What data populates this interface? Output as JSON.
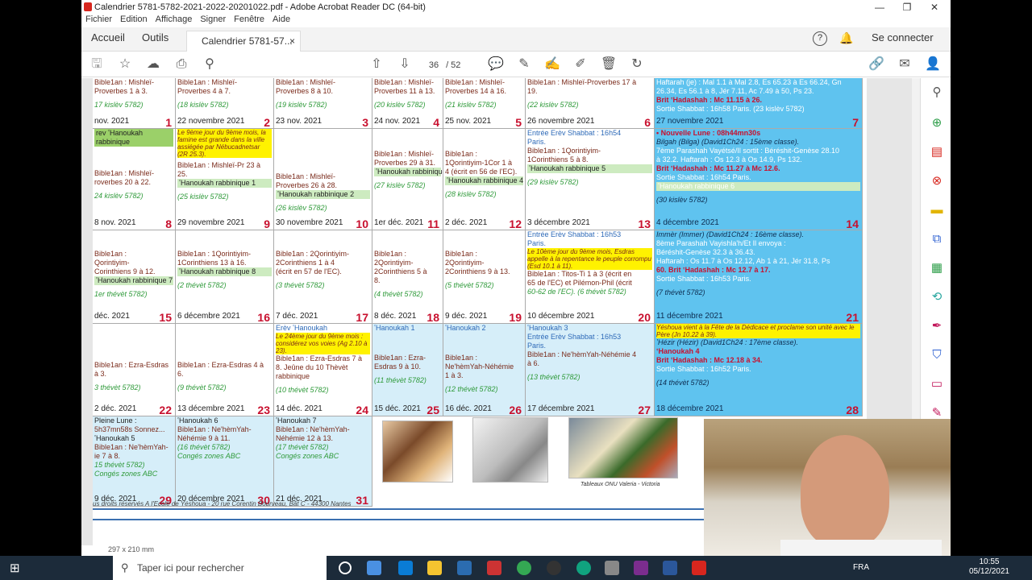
{
  "window": {
    "title": "Calendrier 5781-5782-2021-2022-20201022.pdf - Adobe Acrobat Reader DC (64-bit)",
    "minimize": "—",
    "maximize": "❐",
    "close": "✕"
  },
  "menu": [
    "Fichier",
    "Edition",
    "Affichage",
    "Signer",
    "Fenêtre",
    "Aide"
  ],
  "tabs": {
    "home": "Accueil",
    "tools": "Outils",
    "doc": "Calendrier 5781-57...",
    "close": "×",
    "signin": "Se connecter"
  },
  "toolbar": {
    "page_current": "36",
    "page_total": "/ 52"
  },
  "calendar": {
    "row1": [
      {
        "lines": [
          "Bible1an : Mishleï-",
          "Proverbes 1 à 3."
        ],
        "kislev": "17 kislèv 5782)",
        "date": "nov. 2021",
        "num": "1"
      },
      {
        "lines": [
          "Bible1an : Mishleï-",
          "Proverbes 4 à 7."
        ],
        "kislev": "(18 kislèv 5782)",
        "date": "22 novembre 2021",
        "num": "2"
      },
      {
        "lines": [
          "Bible1an : Mishleï-",
          "Proverbes 8 à 10."
        ],
        "kislev": "(19 kislèv 5782)",
        "date": "23 nov. 2021",
        "num": "3"
      },
      {
        "lines": [
          "Bible1an : Mishleï-",
          "Proverbes 11 à 13."
        ],
        "kislev": "(20 kislèv 5782)",
        "date": "24 nov. 2021",
        "num": "4"
      },
      {
        "lines": [
          "Bible1an : Mishleï-",
          "Proverbes 14 à 16."
        ],
        "kislev": "(21 kislèv 5782)",
        "date": "25 nov. 2021",
        "num": "5"
      },
      {
        "lines": [
          "Bible1an : Mishleï-Proverbes 17 à",
          "19."
        ],
        "kislev": "(22 kislèv 5782)",
        "date": "26 novembre 2021",
        "num": "6"
      },
      {
        "lines": [
          "Haftarah (je) : Mal 1.1 à Mal 2.8, Es 65.23 à Es 66.24, Gn",
          "26.34, Es 56.1 à 8, Jér 7.11, Ac 7.49 à 50, Ps 23.",
          "Brit ʽHadashah : Mc 11.15 à 26.",
          "Sortie Shabbat : 16h58 Paris. (23 kislèv 5782)"
        ],
        "date": "27 novembre 2021",
        "num": "7"
      }
    ],
    "row2": [
      {
        "band": [
          "rev ʽHanoukah",
          "rabbinique"
        ],
        "lines": [
          "Bible1an : Mishleï-",
          "roverbes 20 à 22."
        ],
        "kislev": "24 kislèv 5782)",
        "date": "8 nov. 2021",
        "num": "8"
      },
      {
        "hi": "Le 9ème jour du 9ème mois, la famine est grande dans la ville assiégée par Nébucadnetsar (2R 25.3).",
        "lines": [
          "Bible1an : Mishleï-Pr 23 à",
          "25."
        ],
        "label": "ʽHanoukah rabbinique 1",
        "kislev": "(25 kislèv 5782)",
        "date": "29 novembre 2021",
        "num": "9"
      },
      {
        "lines": [
          "Bible1an : Mishleï-",
          "Proverbes 26 à 28."
        ],
        "label": "ʽHanoukah rabbinique 2",
        "kislev": "(26 kislèv 5782)",
        "date": "30 novembre 2021",
        "num": "10"
      },
      {
        "lines": [
          "Bible1an : Mishleï-",
          "Proverbes 29 à 31."
        ],
        "label": "ʽHanoukah rabbinique 3",
        "kislev": "(27 kislèv 5782)",
        "date": "1er déc. 2021",
        "num": "11"
      },
      {
        "lines": [
          "Bible1an :",
          "1Qorintiyim-1Cor 1 à",
          "4 (écrit en 56 de l'EC)."
        ],
        "label": "ʽHanoukah rabbinique 4",
        "kislev": "(28 kislèv 5782)",
        "date": "2 déc. 2021",
        "num": "12"
      },
      {
        "top": [
          "Entrée Erèv Shabbat : 16h54",
          "Paris."
        ],
        "lines": [
          "Bible1an : 1Qorintiyim-",
          "1Corinthiens 5 à 8."
        ],
        "label": "ʽHanoukah rabbinique 5",
        "kislev": "(29 kislèv 5782)",
        "date": "3 décembre 2021",
        "num": "13"
      },
      {
        "lines": [
          "• Nouvelle Lune : 08h44mn30s",
          "Bilgah (Bilga) (David1Ch24 : 15ème classe).",
          "7ème Parashah Vayétsé/Il sortit : Béréshit-Genèse 28.10",
          "à 32.2. Haftarah : Os 12.3 à Os 14.9, Ps 132.",
          "Brit ʽHadashah : Mc 11.27 à Mc 12.6.",
          "Sortie Shabbat : 16h54 Paris."
        ],
        "label": "ʽHanoukah rabbinique 6",
        "kislev": "(30 kislèv 5782)",
        "date": "4 décembre 2021",
        "num": "14"
      }
    ],
    "row3": [
      {
        "lines": [
          "Bible1an :",
          "Qorintiyim-",
          "Corinthiens 9 à 12."
        ],
        "label": "ʽHanoukah rabbinique 7",
        "kislev": "1er thévèt 5782)",
        "date": "déc. 2021",
        "num": "15"
      },
      {
        "lines": [
          "Bible1an : 1Qorintiyim-",
          "1Corinthiens 13 à 16."
        ],
        "label": "ʽHanoukah rabbinique 8",
        "kislev": "(2 thévèt 5782)",
        "date": "6 décembre 2021",
        "num": "16"
      },
      {
        "lines": [
          "Bible1an : 2Qorintiyim-",
          "2Corinthiens 1 à 4",
          "(écrit en 57 de l'EC)."
        ],
        "kislev": "(3 thévèt 5782)",
        "date": "7 déc. 2021",
        "num": "17"
      },
      {
        "lines": [
          "Bible1an :",
          "2Qorintiyim-",
          "2Corinthiens 5 à",
          "8."
        ],
        "kislev": "(4 thévèt 5782)",
        "date": "8 déc. 2021",
        "num": "18"
      },
      {
        "lines": [
          "Bible1an :",
          "2Qorintiyim-",
          "2Corinthiens 9 à 13."
        ],
        "kislev": "(5 thévèt 5782)",
        "date": "9 déc. 2021",
        "num": "19"
      },
      {
        "top": [
          "Entrée Erèv Shabbat : 16h53",
          "Paris."
        ],
        "hi": "Le 10ème jour du 9ème mois, Esdras appelle à la repentance le peuple corrompu (Esd 10.1 à 11).",
        "lines": [
          "Bible1an : Titos-Ti 1 à 3 (écrit en",
          "65 de l'EC) et Pilémon-Phil (écrit",
          "60-62 de l'EC). (6 thévèt 5782)"
        ],
        "date": "10 décembre 2021",
        "num": "20"
      },
      {
        "lines": [
          "Immèr (Immer) (David1Ch24 : 16ème classe).",
          "8ème Parashah Vayishla'h/Et Il envoya :",
          "Béréshit-Genèse 32.3 à 36.43.",
          "Haftarah : Os 11.7 à Os 12.12, Ab 1 à 21, Jér 31.8, Ps",
          "60.  Brit ʽHadashah : Mc 12.7 à 17.",
          "Sortie Shabbat : 16h53 Paris."
        ],
        "kislev": "(7 thévèt 5782)",
        "date": "11 décembre 2021",
        "num": "21"
      }
    ],
    "row4": [
      {
        "lines": [
          "Bible1an : Ezra-Esdras",
          "à 3."
        ],
        "kislev": "3 thévèt 5782)",
        "date": "2 déc. 2021",
        "num": "22"
      },
      {
        "lines": [
          "Bible1an : Ezra-Esdras 4 à",
          "6."
        ],
        "kislev": "(9 thévèt 5782)",
        "date": "13 décembre 2021",
        "num": "23"
      },
      {
        "top": [
          "Erèv ʽHanoukah"
        ],
        "hi": "Le 24ème jour du 9ème mois : considérez vos voies (Ag 2.10 à 23).",
        "lines": [
          "Bible1an : Ezra-Esdras 7 à",
          "8. Jeûne du 10 Thèvèt",
          "rabbinique"
        ],
        "kislev": "(10 thévèt 5782)",
        "date": "14 déc. 2021",
        "num": "24"
      },
      {
        "top": [
          "ʽHanoukah 1"
        ],
        "lines": [
          "Bible1an : Ezra-",
          "Esdras 9 à 10."
        ],
        "kislev": "(11 thévèt 5782)",
        "date": "15 déc. 2021",
        "num": "25"
      },
      {
        "top": [
          "ʽHanoukah 2"
        ],
        "lines": [
          "Bible1an :",
          "Ne'hèmYah-Néhémie",
          "1 à 3."
        ],
        "kislev": "(12 thévèt 5782)",
        "date": "16 déc. 2021",
        "num": "26"
      },
      {
        "top": [
          "ʽHanoukah 3",
          "Entrée Erèv Shabbat : 16h53",
          "Paris."
        ],
        "lines": [
          "Bible1an : Ne'hèmYah-Néhémie 4",
          "à 6."
        ],
        "kislev": "(13 thévèt 5782)",
        "date": "17 décembre 2021",
        "num": "27"
      },
      {
        "lines": [
          "ʽHézir (Hézir) (David1Ch24 : 17ème classe).",
          "ʽHanoukah 4",
          "Brit ʽHadashah : Mc 12.18 à 34."
        ],
        "hi": "Yéshoua vient à la Fête de la Dédicace et proclame son unité avec le Père (Jn 10.22 à 39).",
        "after": [
          "Sortie Shabbat : 16h52 Paris."
        ],
        "kislev": "(14 thévèt 5782)",
        "date": "18 décembre 2021",
        "num": "28"
      }
    ],
    "row5": [
      {
        "lines": [
          "Pleine Lune :",
          "5h37mn58s Sonnez...",
          "ʽHanoukah 5",
          "Bible1an : Ne'hèmYah-",
          "ie 7 à 8.",
          "15 thévèt 5782)",
          "Congés zones ABC"
        ],
        "date": "9 déc. 2021",
        "num": "29"
      },
      {
        "lines": [
          "ʽHanoukah 6",
          "",
          "Bible1an : Ne'hèmYah-",
          "Néhémie 9 à 11.",
          "(16 thévèt 5782)",
          "Congés zones ABC"
        ],
        "date": "20 décembre 2021",
        "num": "30"
      },
      {
        "lines": [
          "ʽHanoukah 7",
          "",
          "Bible1an : Ne'hèmYah-",
          "Néhémie 12 à 13.",
          "(17 thévèt 5782)",
          "Congés zones ABC"
        ],
        "date": "21 déc. 2021",
        "num": "31"
      }
    ],
    "caption": "Tableaux ONU Valeria - Victoria",
    "footer": "us droits réservés A l'Ecole de Yéshoua - 20 rue Corentin Bourveau, Bât C - 44300 Nantes"
  },
  "status": {
    "page_size": "297 x 210 mm"
  },
  "taskbar": {
    "search": "Taper ici pour rechercher",
    "lang": "FRA",
    "time": "10:55",
    "date": "05/12/2021"
  },
  "colors": {
    "shabbat_bg": "#5fc3ef",
    "light_bg": "#d6eef9",
    "day_num": "#c8102e",
    "highlight": "#fff200"
  }
}
